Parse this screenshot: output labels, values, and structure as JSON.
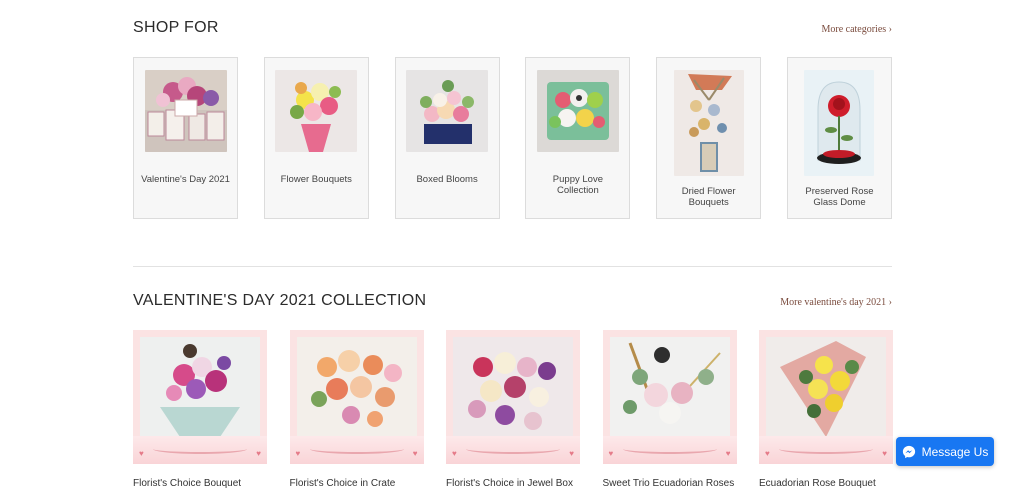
{
  "shop_for": {
    "title": "SHOP FOR",
    "more_label": "More categories ›",
    "categories": [
      {
        "label": "Valentine's Day 2021"
      },
      {
        "label": "Flower Bouquets"
      },
      {
        "label": "Boxed Blooms"
      },
      {
        "label": "Puppy Love Collection"
      },
      {
        "label": "Dried Flower Bouquets"
      },
      {
        "label": "Preserved Rose Glass Dome"
      }
    ]
  },
  "collection": {
    "title": "VALENTINE'S DAY 2021 COLLECTION",
    "more_label": "More valentine's day 2021 ›",
    "products": [
      {
        "name": "Florist's Choice Bouquet"
      },
      {
        "name": "Florist's Choice in Crate"
      },
      {
        "name": "Florist's Choice in Jewel Box"
      },
      {
        "name": "Sweet Trio Ecuadorian Roses"
      },
      {
        "name": "Ecuadorian Rose Bouquet"
      }
    ]
  },
  "messenger": {
    "label": "Message Us",
    "color": "#1877f2",
    "icon": "messenger-icon"
  },
  "colors": {
    "link": "#7a4b3d",
    "card_bg": "#f7f7f7",
    "product_frame": "#fbe3e3"
  }
}
